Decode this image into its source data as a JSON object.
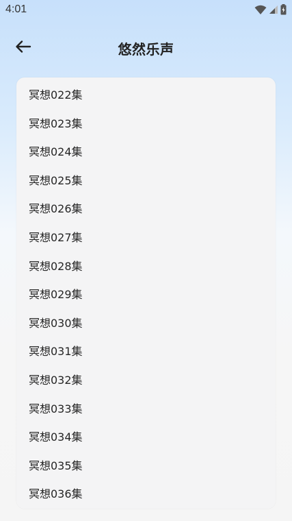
{
  "status_bar": {
    "time": "4:01",
    "icons": [
      "wifi-icon",
      "cellular-signal-icon",
      "battery-charging-icon"
    ]
  },
  "header": {
    "back_icon": "arrow-left-icon",
    "title": "悠然乐声"
  },
  "episodes": [
    "冥想022集",
    "冥想023集",
    "冥想024集",
    "冥想025集",
    "冥想026集",
    "冥想027集",
    "冥想028集",
    "冥想029集",
    "冥想030集",
    "冥想031集",
    "冥想032集",
    "冥想033集",
    "冥想034集",
    "冥想035集",
    "冥想036集"
  ],
  "colors": {
    "gradient_top": "#c7e0fb",
    "background": "#f5f5f5",
    "card": "#f4f4f5",
    "text": "#262626"
  }
}
